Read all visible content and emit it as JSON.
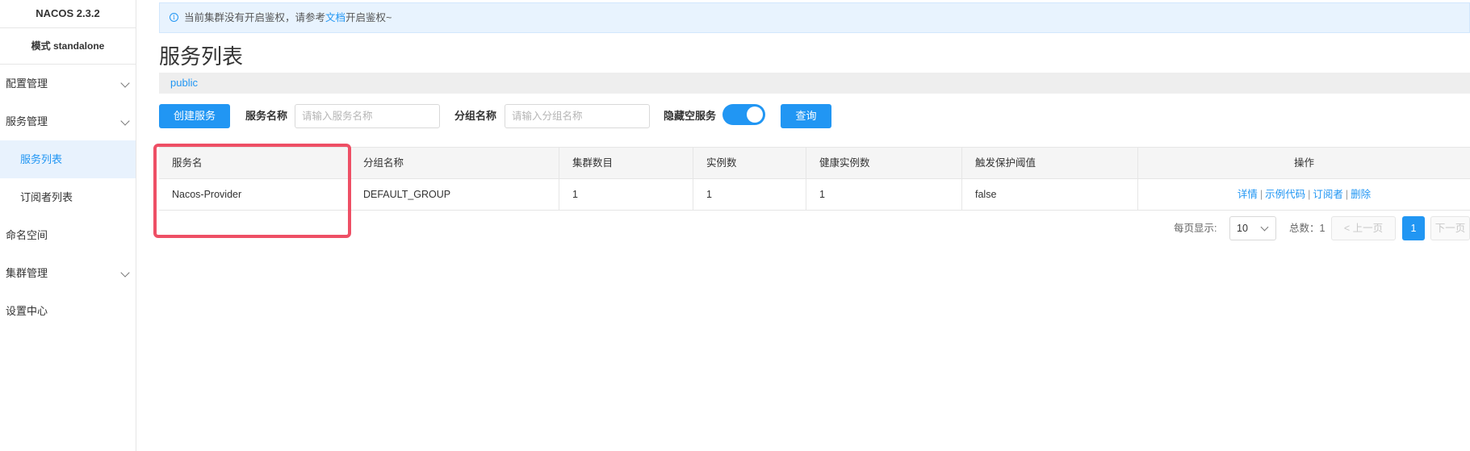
{
  "sidebar": {
    "title": "NACOS 2.3.2",
    "mode": "模式 standalone",
    "items": [
      {
        "label": "配置管理"
      },
      {
        "label": "服务管理"
      },
      {
        "label": "服务列表"
      },
      {
        "label": "订阅者列表"
      },
      {
        "label": "命名空间"
      },
      {
        "label": "集群管理"
      },
      {
        "label": "设置中心"
      }
    ]
  },
  "notice": {
    "text_before": "当前集群没有开启鉴权，请参考",
    "link": "文档",
    "text_after": "开启鉴权~"
  },
  "page": {
    "title": "服务列表",
    "namespace": "public"
  },
  "toolbar": {
    "create_label": "创建服务",
    "service_name_label": "服务名称",
    "service_name_placeholder": "请输入服务名称",
    "group_name_label": "分组名称",
    "group_name_placeholder": "请输入分组名称",
    "hide_empty_label": "隐藏空服务",
    "hide_empty_on": true,
    "query_label": "查询"
  },
  "table": {
    "headers": [
      "服务名",
      "分组名称",
      "集群数目",
      "实例数",
      "健康实例数",
      "触发保护阈值",
      "操作"
    ],
    "rows": [
      {
        "service": "Nacos-Provider",
        "group": "DEFAULT_GROUP",
        "clusters": "1",
        "instances": "1",
        "healthy": "1",
        "threshold": "false"
      }
    ],
    "actions": [
      "详情",
      "示例代码",
      "订阅者",
      "删除"
    ],
    "action_separator": "|"
  },
  "pagination": {
    "per_page_label": "每页显示:",
    "per_page_value": "10",
    "total_label": "总数：1",
    "prev_label": "< 上一页",
    "current_page": "1",
    "next_label": "下一页"
  },
  "colors": {
    "accent": "#2196f3",
    "highlight": "#ee4f65"
  }
}
